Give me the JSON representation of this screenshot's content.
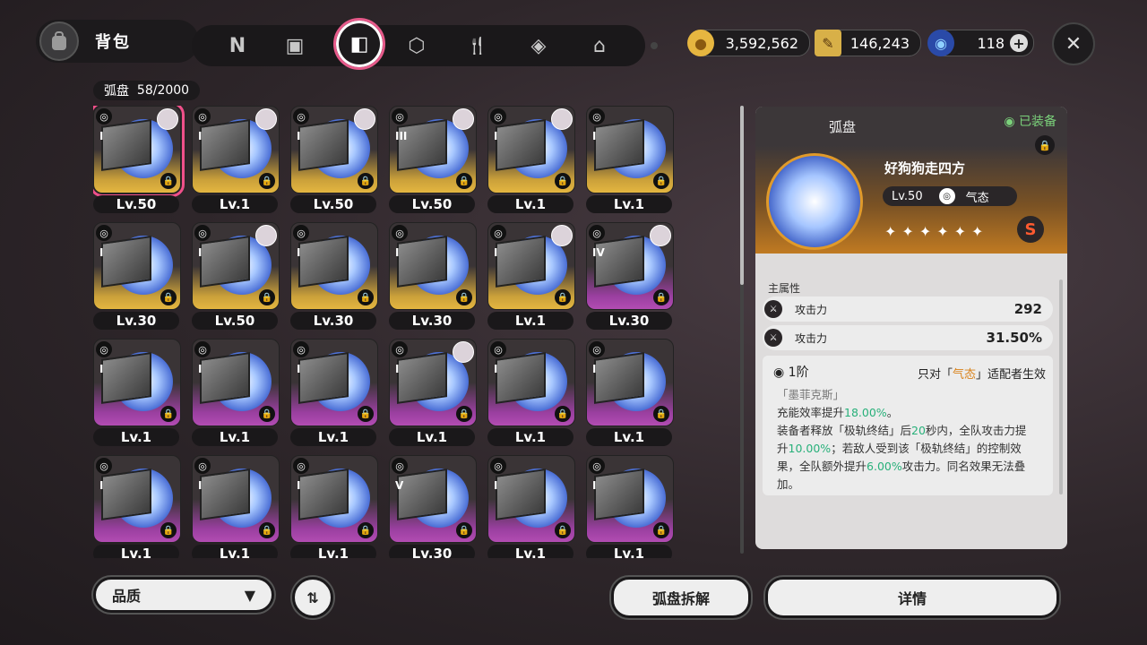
{
  "header": {
    "title": "背包",
    "tabs": [
      {
        "name": "tab-agents",
        "glyph": "N"
      },
      {
        "name": "tab-devices",
        "glyph": "▣"
      },
      {
        "name": "tab-discs",
        "glyph": "◧"
      },
      {
        "name": "tab-materials",
        "glyph": "⬡"
      },
      {
        "name": "tab-food",
        "glyph": "🍴"
      },
      {
        "name": "tab-items",
        "glyph": "◈"
      },
      {
        "name": "tab-home",
        "glyph": "⌂"
      }
    ],
    "currencies": [
      {
        "name": "gold-currency",
        "icon": "coin-icon",
        "value": "3,592,562"
      },
      {
        "name": "ticket-currency",
        "icon": "ticket-icon",
        "value": "146,243"
      },
      {
        "name": "gem-currency",
        "icon": "gem-icon",
        "value": "118"
      }
    ],
    "close_glyph": "✕"
  },
  "inventory": {
    "label": "弧盘",
    "count": "58/2000"
  },
  "cards": [
    {
      "rank": "I",
      "lv": "Lv.50",
      "tone": "gold",
      "avatar": true,
      "sel": true
    },
    {
      "rank": "I",
      "lv": "Lv.1",
      "tone": "gold",
      "avatar": true
    },
    {
      "rank": "I",
      "lv": "Lv.50",
      "tone": "gold",
      "avatar": true
    },
    {
      "rank": "III",
      "lv": "Lv.50",
      "tone": "gold",
      "avatar": true
    },
    {
      "rank": "I",
      "lv": "Lv.1",
      "tone": "gold",
      "avatar": true
    },
    {
      "rank": "I",
      "lv": "Lv.1",
      "tone": "gold",
      "avatar": false
    },
    {
      "rank": "I",
      "lv": "Lv.30",
      "tone": "gold",
      "avatar": false
    },
    {
      "rank": "I",
      "lv": "Lv.50",
      "tone": "gold",
      "avatar": true
    },
    {
      "rank": "I",
      "lv": "Lv.30",
      "tone": "gold",
      "avatar": false
    },
    {
      "rank": "I",
      "lv": "Lv.30",
      "tone": "gold",
      "avatar": false
    },
    {
      "rank": "I",
      "lv": "Lv.1",
      "tone": "gold",
      "avatar": true
    },
    {
      "rank": "IV",
      "lv": "Lv.30",
      "tone": "purple",
      "avatar": true
    },
    {
      "rank": "I",
      "lv": "Lv.1",
      "tone": "purple",
      "avatar": false
    },
    {
      "rank": "I",
      "lv": "Lv.1",
      "tone": "purple",
      "avatar": false
    },
    {
      "rank": "I",
      "lv": "Lv.1",
      "tone": "purple",
      "avatar": false
    },
    {
      "rank": "I",
      "lv": "Lv.1",
      "tone": "purple",
      "avatar": true
    },
    {
      "rank": "I",
      "lv": "Lv.1",
      "tone": "purple",
      "avatar": false
    },
    {
      "rank": "I",
      "lv": "Lv.1",
      "tone": "purple",
      "avatar": false
    },
    {
      "rank": "I",
      "lv": "Lv.1",
      "tone": "purple",
      "avatar": false
    },
    {
      "rank": "I",
      "lv": "Lv.1",
      "tone": "purple",
      "avatar": false
    },
    {
      "rank": "I",
      "lv": "Lv.1",
      "tone": "purple",
      "avatar": false
    },
    {
      "rank": "V",
      "lv": "Lv.30",
      "tone": "purple",
      "avatar": false
    },
    {
      "rank": "I",
      "lv": "Lv.1",
      "tone": "purple",
      "avatar": false
    },
    {
      "rank": "I",
      "lv": "Lv.1",
      "tone": "purple",
      "avatar": false
    }
  ],
  "controls": {
    "filter_label": "品质",
    "sort_glyph": "⇅",
    "dismantle_label": "弧盘拆解",
    "details_label": "详情"
  },
  "detail": {
    "title": "弧盘",
    "equipped": "◉ 已装备",
    "name": "好狗狗走四方",
    "level": "Lv.50",
    "attribute": "气态",
    "stars": "✦✦✦✦✦✦",
    "rank_badge": "S",
    "main_stat_label": "主属性",
    "stats": [
      {
        "name": "攻击力",
        "value": "292"
      },
      {
        "name": "攻击力",
        "value": "31.50%"
      }
    ],
    "effect_tier": "1阶",
    "effect_condition_pre": "只对「",
    "effect_condition_hl": "气态",
    "effect_condition_post": "」适配者生效",
    "effect_lines": [
      "「墨菲克斯」",
      "充能效率提升18.00%。",
      "装备者释放「极轨终结」后20秒内，全队攻击力提",
      "升10.00%；若敌人受到该「极轨终结」的控制效",
      "果，全队额外提升6.00%攻击力。同名效果无法叠",
      "加。"
    ]
  },
  "colors": {
    "accent_pink": "#f0508a",
    "gold_tier": "#e4b640",
    "purple_tier": "#b24cb2",
    "highlight_green": "#28b07a",
    "highlight_orange": "#d9821a"
  }
}
